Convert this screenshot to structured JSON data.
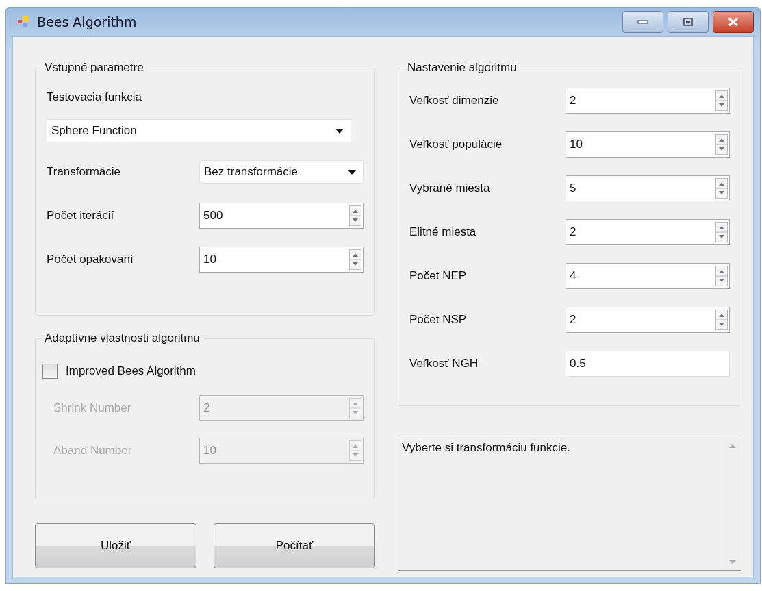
{
  "window": {
    "title": "Bees Algorithm"
  },
  "input_parameters": {
    "title": "Vstupné parametre",
    "test_function": {
      "label": "Testovacia funkcia",
      "value": "Sphere Function"
    },
    "transformation": {
      "label": "Transformácie",
      "value": "Bez transformácie"
    },
    "spinners": [
      {
        "label": "Počet iterácií",
        "value": "500"
      },
      {
        "label": "Počet opakovaní",
        "value": "10"
      }
    ]
  },
  "adaptive": {
    "title": "Adaptívne vlastnosti algoritmu",
    "checkbox": {
      "label": "Improved Bees Algorithm",
      "checked": false
    },
    "spinners": [
      {
        "label": "Shrink Number",
        "value": "2",
        "disabled": true
      },
      {
        "label": "Aband Number",
        "value": "10",
        "disabled": true
      }
    ]
  },
  "buttons": [
    "Uložiť",
    "Počítať"
  ],
  "algorithm_settings": {
    "title": "Nastavenie algoritmu",
    "fields": [
      {
        "label": "Veľkosť dimenzie",
        "value": "2",
        "kind": "spinner"
      },
      {
        "label": "Veľkosť populácie",
        "value": "10",
        "kind": "spinner"
      },
      {
        "label": "Vybrané miesta",
        "value": "5",
        "kind": "spinner"
      },
      {
        "label": "Elitné miesta",
        "value": "2",
        "kind": "spinner"
      },
      {
        "label": "Počet NEP",
        "value": "4",
        "kind": "spinner"
      },
      {
        "label": "Počet NSP",
        "value": "2",
        "kind": "spinner"
      },
      {
        "label": "Veľkosť NGH",
        "value": "0.5",
        "kind": "text"
      }
    ]
  },
  "message": {
    "text": "Vyberte si transformáciu funkcie."
  }
}
